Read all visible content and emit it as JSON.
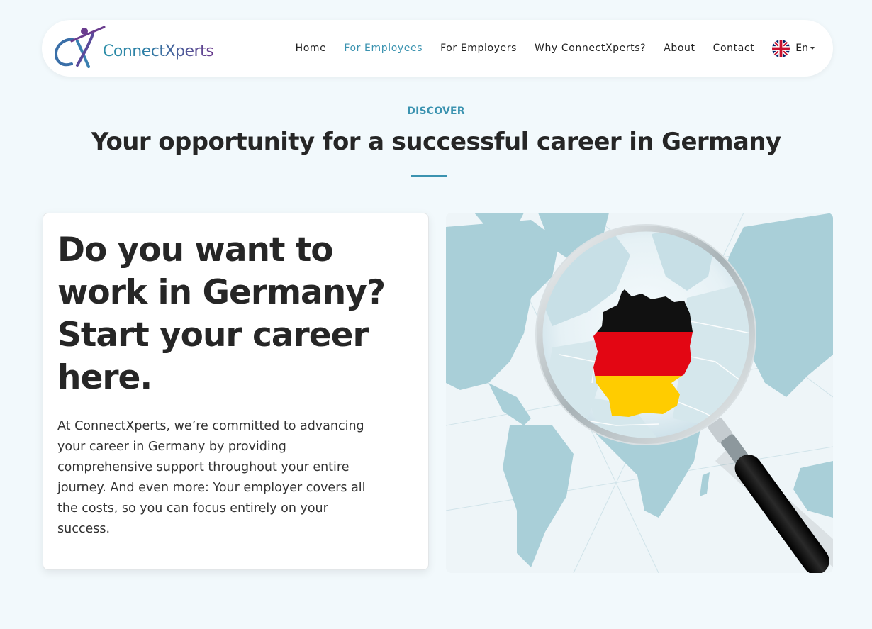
{
  "header": {
    "logo_text": "ConnectXperts",
    "nav": [
      {
        "label": "Home",
        "active": false
      },
      {
        "label": "For Employees",
        "active": true
      },
      {
        "label": "For Employers",
        "active": false
      },
      {
        "label": "Why ConnectXperts?",
        "active": false
      },
      {
        "label": "About",
        "active": false
      },
      {
        "label": "Contact",
        "active": false
      }
    ],
    "language": {
      "label": "En",
      "flag_icon": "uk-flag-icon"
    }
  },
  "section": {
    "eyebrow": "DISCOVER",
    "title": "Your opportunity for a successful career in Germany"
  },
  "card": {
    "heading": "Do you want to work in Germany? Start your career here.",
    "body": "At ConnectXperts, we’re committed to advancing your career in Germany by providing comprehensive support throughout your entire journey. And even more: Your employer covers all the costs, so you can focus entirely on your success."
  },
  "figure": {
    "subject": "magnifying-glass-over-world-map-germany-flag"
  },
  "colors": {
    "accent": "#3b93b0",
    "background": "#f2f9fc",
    "brand_purple": "#6a3c8e",
    "flag_black": "#111111",
    "flag_red": "#e30613",
    "flag_gold": "#ffcc00"
  }
}
